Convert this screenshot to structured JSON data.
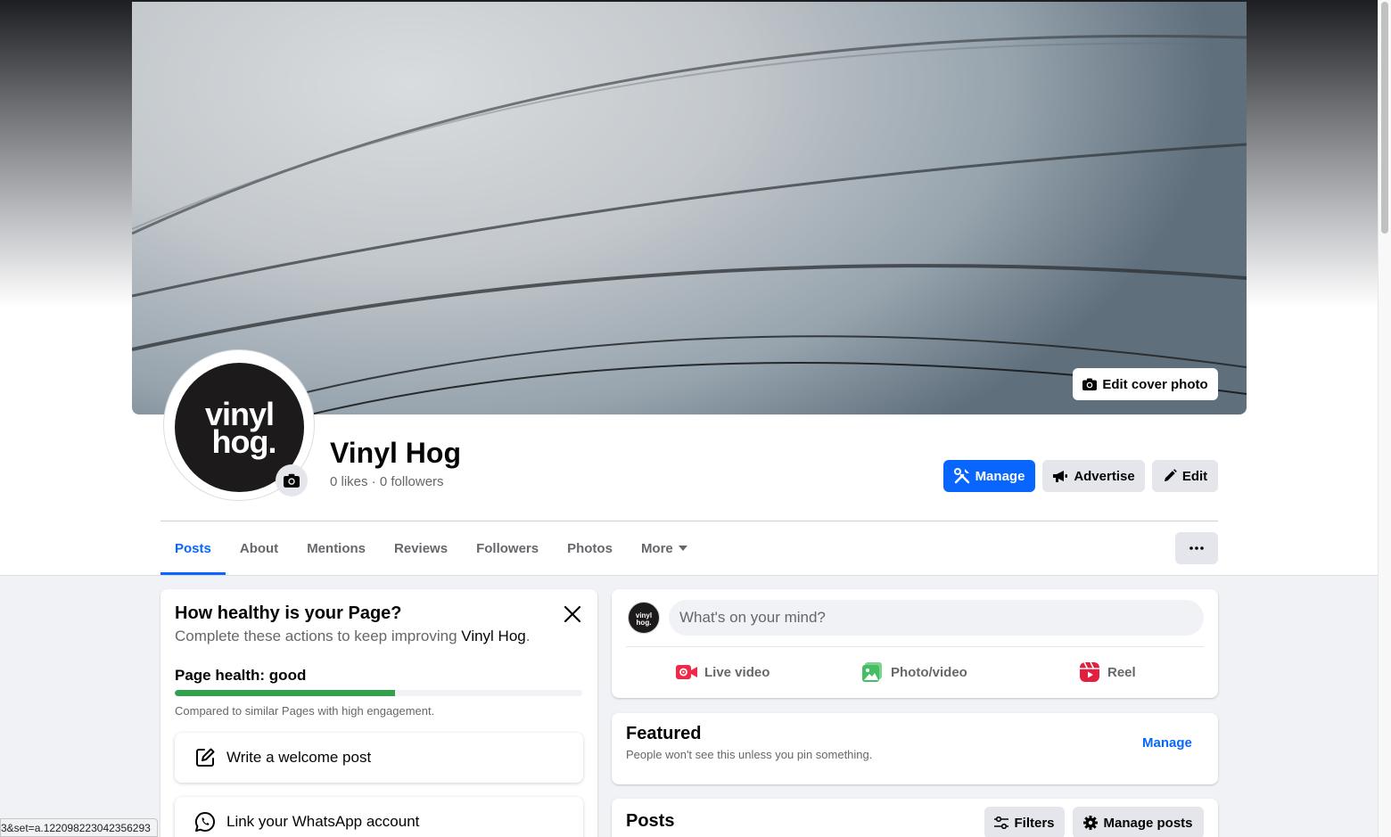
{
  "cover": {
    "edit_label": "Edit cover photo"
  },
  "profile": {
    "avatar_line1": "vinyl",
    "avatar_line2": "hog.",
    "name": "Vinyl Hog",
    "stats": "0 likes · 0 followers"
  },
  "actions": {
    "manage": "Manage",
    "advertise": "Advertise",
    "edit": "Edit"
  },
  "tabs": [
    {
      "label": "Posts",
      "active": true
    },
    {
      "label": "About"
    },
    {
      "label": "Mentions"
    },
    {
      "label": "Reviews"
    },
    {
      "label": "Followers"
    },
    {
      "label": "Photos"
    },
    {
      "label": "More"
    }
  ],
  "health": {
    "title": "How healthy is your Page?",
    "subtitle_prefix": "Complete these actions to keep improving ",
    "subtitle_name": "Vinyl Hog",
    "subtitle_suffix": ".",
    "label": "Page health: good",
    "progress": 0.54,
    "note": "Compared to similar Pages with high engagement.",
    "items": [
      {
        "label": "Write a welcome post",
        "icon": "compose-icon"
      },
      {
        "label": "Link your WhatsApp account",
        "icon": "whatsapp-icon"
      }
    ]
  },
  "composer": {
    "avatar_line1": "vinyl",
    "avatar_line2": "hog.",
    "placeholder": "What's on your mind?",
    "live": "Live video",
    "photo": "Photo/video",
    "reel": "Reel"
  },
  "featured": {
    "title": "Featured",
    "subtitle": "People won't see this unless you pin something.",
    "manage": "Manage"
  },
  "posts": {
    "title": "Posts",
    "filters": "Filters",
    "manage": "Manage posts"
  },
  "status_bar": {
    "url": "3&set=a.122098223042356293"
  },
  "colors": {
    "accent": "#0866ff",
    "progress": "#31a24c",
    "live": "#f02849",
    "photo": "#45bd62",
    "reel": "#e41e3f"
  }
}
